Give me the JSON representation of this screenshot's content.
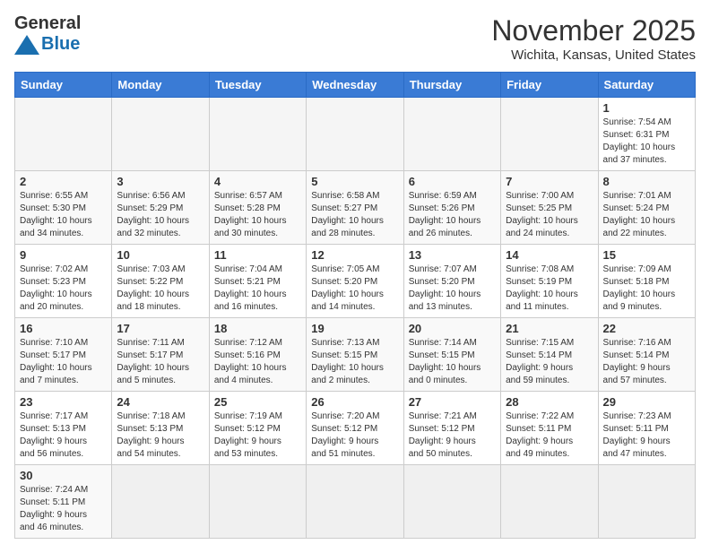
{
  "header": {
    "logo_general": "General",
    "logo_blue": "Blue",
    "month_title": "November 2025",
    "location": "Wichita, Kansas, United States"
  },
  "days_of_week": [
    "Sunday",
    "Monday",
    "Tuesday",
    "Wednesday",
    "Thursday",
    "Friday",
    "Saturday"
  ],
  "weeks": [
    [
      {
        "day": "",
        "info": ""
      },
      {
        "day": "",
        "info": ""
      },
      {
        "day": "",
        "info": ""
      },
      {
        "day": "",
        "info": ""
      },
      {
        "day": "",
        "info": ""
      },
      {
        "day": "",
        "info": ""
      },
      {
        "day": "1",
        "info": "Sunrise: 7:54 AM\nSunset: 6:31 PM\nDaylight: 10 hours\nand 37 minutes."
      }
    ],
    [
      {
        "day": "2",
        "info": "Sunrise: 6:55 AM\nSunset: 5:30 PM\nDaylight: 10 hours\nand 34 minutes."
      },
      {
        "day": "3",
        "info": "Sunrise: 6:56 AM\nSunset: 5:29 PM\nDaylight: 10 hours\nand 32 minutes."
      },
      {
        "day": "4",
        "info": "Sunrise: 6:57 AM\nSunset: 5:28 PM\nDaylight: 10 hours\nand 30 minutes."
      },
      {
        "day": "5",
        "info": "Sunrise: 6:58 AM\nSunset: 5:27 PM\nDaylight: 10 hours\nand 28 minutes."
      },
      {
        "day": "6",
        "info": "Sunrise: 6:59 AM\nSunset: 5:26 PM\nDaylight: 10 hours\nand 26 minutes."
      },
      {
        "day": "7",
        "info": "Sunrise: 7:00 AM\nSunset: 5:25 PM\nDaylight: 10 hours\nand 24 minutes."
      },
      {
        "day": "8",
        "info": "Sunrise: 7:01 AM\nSunset: 5:24 PM\nDaylight: 10 hours\nand 22 minutes."
      }
    ],
    [
      {
        "day": "9",
        "info": "Sunrise: 7:02 AM\nSunset: 5:23 PM\nDaylight: 10 hours\nand 20 minutes."
      },
      {
        "day": "10",
        "info": "Sunrise: 7:03 AM\nSunset: 5:22 PM\nDaylight: 10 hours\nand 18 minutes."
      },
      {
        "day": "11",
        "info": "Sunrise: 7:04 AM\nSunset: 5:21 PM\nDaylight: 10 hours\nand 16 minutes."
      },
      {
        "day": "12",
        "info": "Sunrise: 7:05 AM\nSunset: 5:20 PM\nDaylight: 10 hours\nand 14 minutes."
      },
      {
        "day": "13",
        "info": "Sunrise: 7:07 AM\nSunset: 5:20 PM\nDaylight: 10 hours\nand 13 minutes."
      },
      {
        "day": "14",
        "info": "Sunrise: 7:08 AM\nSunset: 5:19 PM\nDaylight: 10 hours\nand 11 minutes."
      },
      {
        "day": "15",
        "info": "Sunrise: 7:09 AM\nSunset: 5:18 PM\nDaylight: 10 hours\nand 9 minutes."
      }
    ],
    [
      {
        "day": "16",
        "info": "Sunrise: 7:10 AM\nSunset: 5:17 PM\nDaylight: 10 hours\nand 7 minutes."
      },
      {
        "day": "17",
        "info": "Sunrise: 7:11 AM\nSunset: 5:17 PM\nDaylight: 10 hours\nand 5 minutes."
      },
      {
        "day": "18",
        "info": "Sunrise: 7:12 AM\nSunset: 5:16 PM\nDaylight: 10 hours\nand 4 minutes."
      },
      {
        "day": "19",
        "info": "Sunrise: 7:13 AM\nSunset: 5:15 PM\nDaylight: 10 hours\nand 2 minutes."
      },
      {
        "day": "20",
        "info": "Sunrise: 7:14 AM\nSunset: 5:15 PM\nDaylight: 10 hours\nand 0 minutes."
      },
      {
        "day": "21",
        "info": "Sunrise: 7:15 AM\nSunset: 5:14 PM\nDaylight: 9 hours\nand 59 minutes."
      },
      {
        "day": "22",
        "info": "Sunrise: 7:16 AM\nSunset: 5:14 PM\nDaylight: 9 hours\nand 57 minutes."
      }
    ],
    [
      {
        "day": "23",
        "info": "Sunrise: 7:17 AM\nSunset: 5:13 PM\nDaylight: 9 hours\nand 56 minutes."
      },
      {
        "day": "24",
        "info": "Sunrise: 7:18 AM\nSunset: 5:13 PM\nDaylight: 9 hours\nand 54 minutes."
      },
      {
        "day": "25",
        "info": "Sunrise: 7:19 AM\nSunset: 5:12 PM\nDaylight: 9 hours\nand 53 minutes."
      },
      {
        "day": "26",
        "info": "Sunrise: 7:20 AM\nSunset: 5:12 PM\nDaylight: 9 hours\nand 51 minutes."
      },
      {
        "day": "27",
        "info": "Sunrise: 7:21 AM\nSunset: 5:12 PM\nDaylight: 9 hours\nand 50 minutes."
      },
      {
        "day": "28",
        "info": "Sunrise: 7:22 AM\nSunset: 5:11 PM\nDaylight: 9 hours\nand 49 minutes."
      },
      {
        "day": "29",
        "info": "Sunrise: 7:23 AM\nSunset: 5:11 PM\nDaylight: 9 hours\nand 47 minutes."
      }
    ],
    [
      {
        "day": "30",
        "info": "Sunrise: 7:24 AM\nSunset: 5:11 PM\nDaylight: 9 hours\nand 46 minutes."
      },
      {
        "day": "",
        "info": ""
      },
      {
        "day": "",
        "info": ""
      },
      {
        "day": "",
        "info": ""
      },
      {
        "day": "",
        "info": ""
      },
      {
        "day": "",
        "info": ""
      },
      {
        "day": "",
        "info": ""
      }
    ]
  ]
}
